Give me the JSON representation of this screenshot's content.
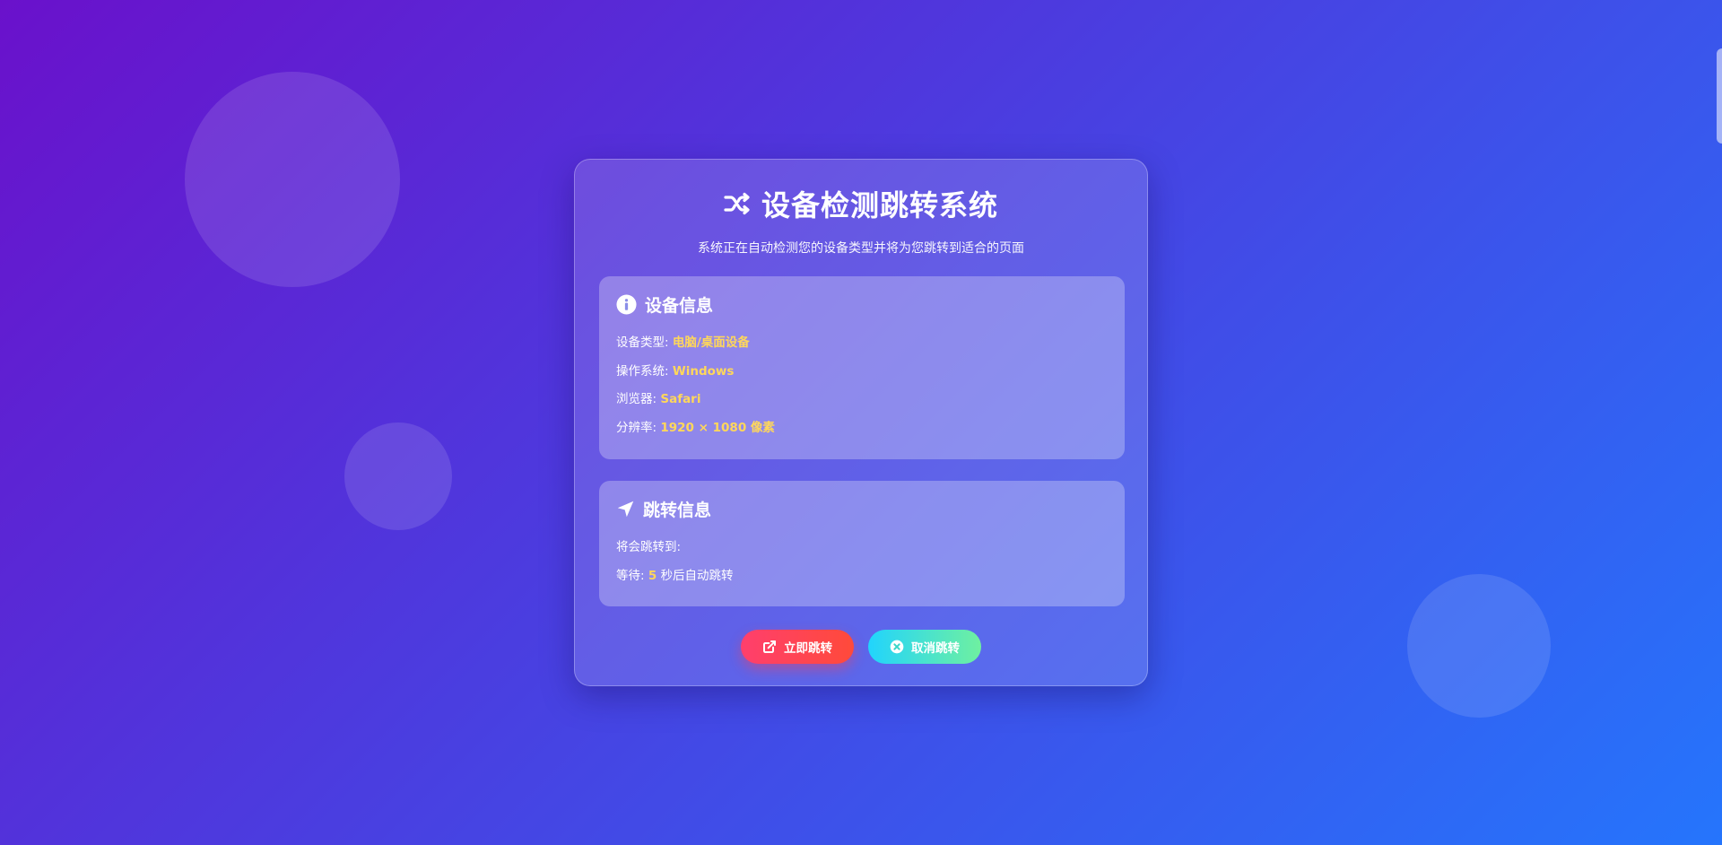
{
  "header": {
    "title": "设备检测跳转系统",
    "subtitle": "系统正在自动检测您的设备类型并将为您跳转到适合的页面"
  },
  "device_panel": {
    "title": "设备信息",
    "rows": [
      {
        "label": "设备类型:",
        "value": "电脑/桌面设备"
      },
      {
        "label": "操作系统:",
        "value": "Windows"
      },
      {
        "label": "浏览器:",
        "value": "Safari"
      },
      {
        "label": "分辨率:",
        "value": "1920 × 1080 像素"
      }
    ]
  },
  "redirect_panel": {
    "title": "跳转信息",
    "target_label": "将会跳转到:",
    "target_value": "",
    "wait_label": "等待:",
    "wait_seconds": "5",
    "wait_suffix": "秒后自动跳转"
  },
  "actions": {
    "go_label": "立即跳转",
    "cancel_label": "取消跳转"
  },
  "colors": {
    "highlight": "#ffd75a",
    "go_button": "#ff4a5a",
    "cancel_button": "#3fe0d0"
  },
  "icons": {
    "title": "shuffle-icon",
    "device": "info-circle-icon",
    "redirect": "location-arrow-icon",
    "go": "external-link-icon",
    "cancel": "close-circle-icon"
  }
}
